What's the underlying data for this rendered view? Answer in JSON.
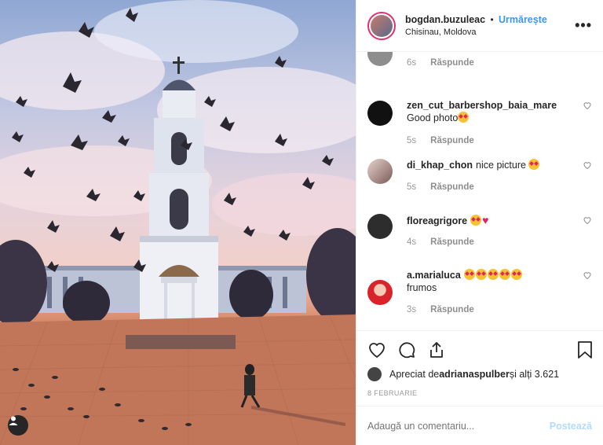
{
  "header": {
    "username": "bogdan.buzuleac",
    "separator": "•",
    "follow_label": "Urmărește",
    "location": "Chisinau, Moldova",
    "more_label": "•••"
  },
  "comments": [
    {
      "user": "",
      "text": "",
      "time": "6s",
      "reply": "Răspunde"
    },
    {
      "user": "zen_cut_barbershop_baia_mare",
      "text": "Good photo",
      "time": "5s",
      "reply": "Răspunde"
    },
    {
      "user": "di_khap_chon",
      "text": "nice picture",
      "time": "5s",
      "reply": "Răspunde"
    },
    {
      "user": "floreagrigore",
      "text": "",
      "time": "4s",
      "reply": "Răspunde"
    },
    {
      "user": "a.marialuca",
      "text": "frumos",
      "time": "3s",
      "reply": "Răspunde"
    }
  ],
  "likes": {
    "prefix": "Apreciat de ",
    "user": "adrianaspulber",
    "suffix": " și alți 3.621"
  },
  "date": "8 FEBRUARIE",
  "add_comment": {
    "placeholder": "Adaugă un comentariu...",
    "post_label": "Postează"
  },
  "colors": {
    "accent": "#3897f0",
    "post_disabled": "#b3dbff",
    "like_red": "#e0245e"
  },
  "icons": [
    "heart-icon",
    "comment-icon",
    "share-icon",
    "bookmark-icon",
    "user-tag-icon",
    "more-icon"
  ]
}
